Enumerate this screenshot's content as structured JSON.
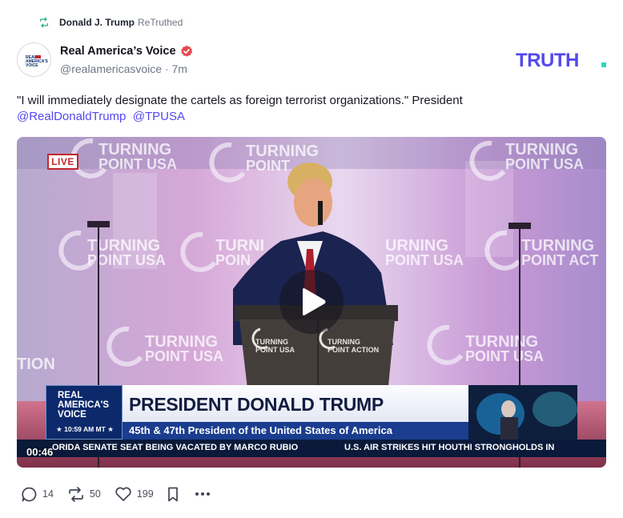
{
  "retruth": {
    "user": "Donald J. Trump",
    "action": "ReTruthed",
    "icon": "retruth-icon"
  },
  "author": {
    "name": "Real America’s Voice",
    "handle": "@realamericasvoice · 7m",
    "verified_icon": "verified-badge-icon",
    "avatar_text": [
      "REAL",
      "AMERICA'S",
      "VOICE"
    ]
  },
  "brand": {
    "logo_text": "TRUTH",
    "colors": {
      "text": "#5448ee",
      "dot": "#2fd7c3"
    }
  },
  "post": {
    "text": "\"I will immediately designate the cartels as foreign terrorist organizations.\" President",
    "mention_1": "@RealDonaldTrump",
    "mention_2": "@TPUSA"
  },
  "video": {
    "live_label": "LIVE",
    "network_lines": [
      "REAL",
      "AMERICA'S",
      "VOICE"
    ],
    "time_label": "10:59 AM MT",
    "headline": "PRESIDENT DONALD TRUMP",
    "subheadline": "45th & 47th President of the United States of America",
    "ticker_left": "ORIDA SENATE SEAT BEING VACATED BY MARCO RUBIO",
    "ticker_right": "U.S. AIR STRIKES HIT HOUTHI STRONGHOLDS IN",
    "timestamp": "00:46",
    "backdrop_text": [
      "TURNING POINT USA",
      "TURNING POINT ACTION"
    ],
    "play_icon": "play-icon"
  },
  "actions": {
    "replies": {
      "icon": "reply-icon",
      "count": "14"
    },
    "retruths": {
      "icon": "retruth-icon",
      "count": "50"
    },
    "likes": {
      "icon": "heart-icon",
      "count": "199"
    },
    "bookmark": {
      "icon": "bookmark-icon"
    },
    "more": {
      "icon": "more-icon"
    }
  }
}
